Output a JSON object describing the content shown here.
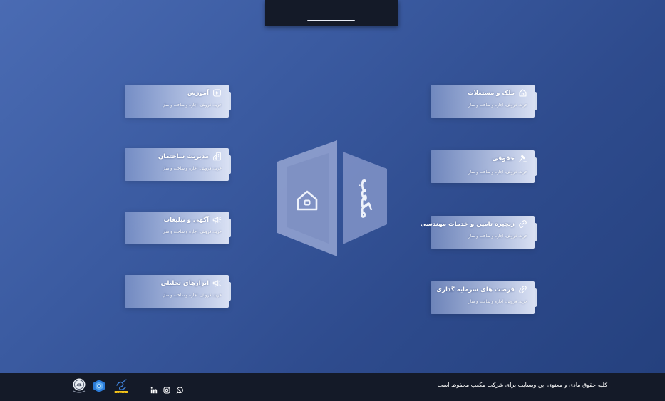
{
  "header": {
    "tab": "top-tab"
  },
  "cube": {
    "brand": "مکعب",
    "icon": "home-icon"
  },
  "right_cards": [
    {
      "title": "ملک و مستغلات",
      "subtitle": "خرید، فروش، اجاره و ساخت و ساز",
      "icon": "home-icon"
    },
    {
      "title": "حقوقی",
      "subtitle": "خرید، فروش، اجاره و ساخت و ساز",
      "icon": "gavel-icon"
    },
    {
      "title": "زنجیره تامین و خدمات مهندسی",
      "subtitle": "خرید، فروش، اجاره و ساخت و ساز",
      "icon": "link-icon"
    },
    {
      "title": "فرصت های سرمایه گذاری",
      "subtitle": "خرید، فروش، اجاره و ساخت و ساز",
      "icon": "link-icon"
    }
  ],
  "left_cards": [
    {
      "title": "آموزش",
      "subtitle": "خرید، فروش، اجاره و ساخت و ساز",
      "icon": "play-icon"
    },
    {
      "title": "مدیریت ساختمان",
      "subtitle": "خرید، فروش، اجاره و ساخت و ساز",
      "icon": "building-icon"
    },
    {
      "title": "آگهی و تبلیغات",
      "subtitle": "خرید، فروش، اجاره و ساخت و ساز",
      "icon": "megaphone-icon"
    },
    {
      "title": "ابزارهای تحلیلی",
      "subtitle": "خرید، فروش، اجاره و ساخت و ساز",
      "icon": "megaphone-icon"
    }
  ],
  "footer": {
    "copyright": "کلیه حقوق مادی و معنوی این وبسایت برای شرکت مکعب محفوظ است",
    "social": [
      "linkedin-icon",
      "instagram-icon",
      "whatsapp-icon"
    ],
    "badges": [
      "enamad-badge",
      "samandehi-badge",
      "emblem-badge"
    ]
  },
  "colors": {
    "background": "#3a5aa0",
    "footer": "#141a28",
    "card": "#cfd8f0"
  }
}
